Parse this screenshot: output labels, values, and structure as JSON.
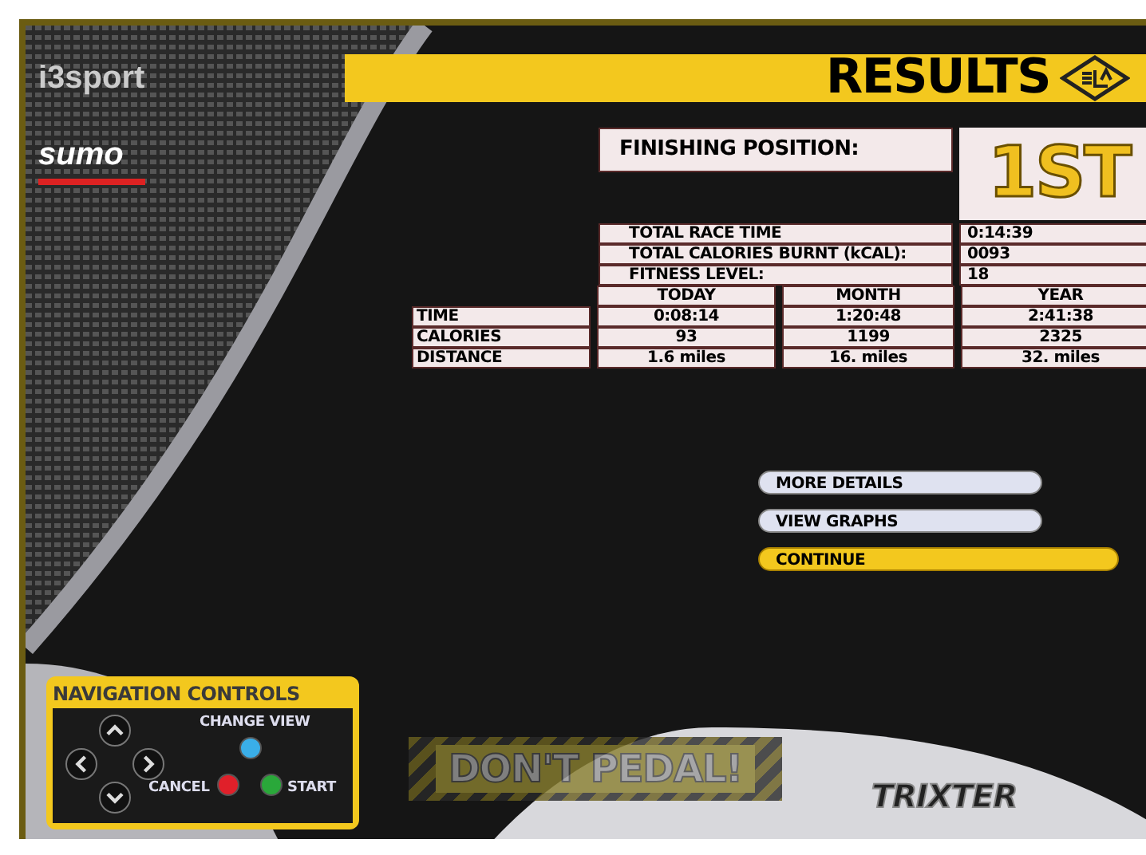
{
  "logos": {
    "top": "i3sport",
    "middle": "sumo",
    "bottom": "TRIXTER"
  },
  "header": {
    "title": "RESULTS"
  },
  "finishing_position": {
    "label": "FINISHING POSITION:",
    "value": "1ST"
  },
  "summary": [
    {
      "label": "TOTAL RACE TIME",
      "value": "0:14:39"
    },
    {
      "label": "TOTAL CALORIES BURNT (kCAL):",
      "value": "0093"
    },
    {
      "label": "FITNESS LEVEL:",
      "value": "18"
    }
  ],
  "stats": {
    "columns": [
      "TODAY",
      "MONTH",
      "YEAR"
    ],
    "rows": [
      {
        "label": "TIME",
        "cells": [
          "0:08:14",
          "1:20:48",
          "2:41:38"
        ]
      },
      {
        "label": "CALORIES",
        "cells": [
          "93",
          "1199",
          "2325"
        ]
      },
      {
        "label": "DISTANCE",
        "cells": [
          "1.6 miles",
          "16. miles",
          "32. miles"
        ]
      }
    ]
  },
  "menu": [
    {
      "label": "MORE DETAILS",
      "selected": false
    },
    {
      "label": "VIEW GRAPHS",
      "selected": false
    },
    {
      "label": "CONTINUE",
      "selected": true
    }
  ],
  "navigation": {
    "title": "NAVIGATION CONTROLS",
    "change_view": "CHANGE VIEW",
    "cancel": "CANCEL",
    "start": "START"
  },
  "warning": "DON'T PEDAL!"
}
